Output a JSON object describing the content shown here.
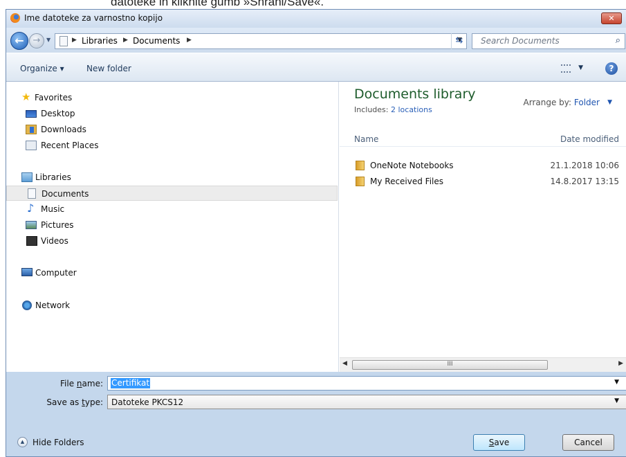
{
  "document": {
    "caption": "datoteke in kliknite gumb »Shrani/Save«."
  },
  "window": {
    "title": "Ime datoteke za varnostno kopijo",
    "close_label": "✕"
  },
  "nav": {
    "breadcrumbs": [
      "Libraries",
      "Documents"
    ],
    "search_placeholder": "Search Documents"
  },
  "toolbar": {
    "organize_label": "Organize ▾",
    "new_folder_label": "New folder",
    "help_label": "?"
  },
  "sidebar": {
    "favorites_label": "Favorites",
    "favorites": [
      {
        "label": "Desktop",
        "icon": "desktop-icon"
      },
      {
        "label": "Downloads",
        "icon": "downloads-icon"
      },
      {
        "label": "Recent Places",
        "icon": "recent-places-icon"
      }
    ],
    "libraries_label": "Libraries",
    "libraries": [
      {
        "label": "Documents",
        "icon": "document-icon",
        "selected": true
      },
      {
        "label": "Music",
        "icon": "music-icon"
      },
      {
        "label": "Pictures",
        "icon": "pictures-icon"
      },
      {
        "label": "Videos",
        "icon": "videos-icon"
      }
    ],
    "computer_label": "Computer",
    "network_label": "Network"
  },
  "content": {
    "library_title": "Documents library",
    "includes_prefix": "Includes:",
    "includes_link": "2 locations",
    "arrange_label": "Arrange by:",
    "arrange_value": "Folder",
    "columns": {
      "name": "Name",
      "date": "Date modified"
    },
    "files": [
      {
        "name": "OneNote Notebooks",
        "date": "21.1.2018 10:06"
      },
      {
        "name": "My Received Files",
        "date": "14.8.2017 13:15"
      }
    ],
    "scroll_grip": "III"
  },
  "form": {
    "file_name_label_pre": "File ",
    "file_name_label_u": "n",
    "file_name_label_post": "ame:",
    "file_name_value": "Certifikat",
    "type_label_pre": "Save as ",
    "type_label_u": "t",
    "type_label_post": "ype:",
    "type_value": "Datoteke PKCS12"
  },
  "footer": {
    "hide_folders_label": "Hide Folders",
    "save_u": "S",
    "save_rest": "ave",
    "cancel_label": "Cancel"
  }
}
